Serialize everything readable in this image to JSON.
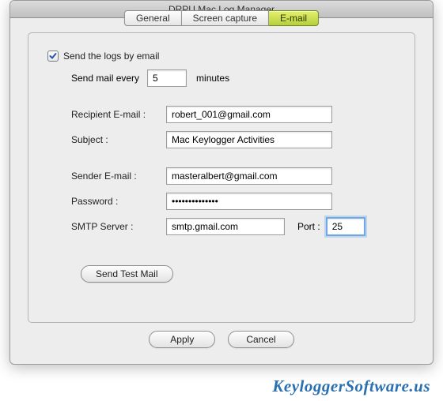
{
  "window": {
    "title": "DRPU Mac Log Manager"
  },
  "tabs": [
    {
      "label": "General"
    },
    {
      "label": "Screen capture"
    },
    {
      "label": "E-mail"
    }
  ],
  "email": {
    "checkbox_label": "Send the logs by email",
    "checked": true,
    "interval_label": "Send mail every",
    "interval_value": "5",
    "interval_unit": "minutes",
    "recipient_label": "Recipient E-mail :",
    "recipient_value": "robert_001@gmail.com",
    "subject_label": "Subject :",
    "subject_value": "Mac Keylogger Activities",
    "sender_label": "Sender E-mail :",
    "sender_value": "masteralbert@gmail.com",
    "password_label": "Password :",
    "password_value": "••••••••••••••",
    "smtp_label": "SMTP Server :",
    "smtp_value": "smtp.gmail.com",
    "port_label": "Port :",
    "port_value": "25",
    "test_button": "Send Test Mail"
  },
  "buttons": {
    "apply": "Apply",
    "cancel": "Cancel"
  },
  "watermark": "KeyloggerSoftware.us"
}
